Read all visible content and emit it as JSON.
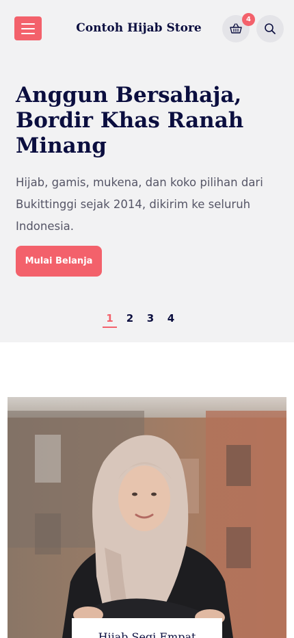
{
  "header": {
    "store_name": "Contoh Hijab Store",
    "cart_count": "4"
  },
  "hero": {
    "title": "Anggun Bersahaja, Bordir Khas Ranah Minang",
    "description": "Hijab, gamis, mukena, dan koko pilihan dari Bukittinggi sejak 2014, dikirim ke seluruh Indonesia.",
    "cta_label": "Mulai Belanja",
    "pages": [
      "1",
      "2",
      "3",
      "4"
    ],
    "active_page": "1"
  },
  "product": {
    "name": "Hijab Segi Empat"
  },
  "colors": {
    "accent": "#f3616b",
    "navy": "#0b0e3f",
    "hero_bg": "#f2f2f3"
  },
  "icons": {
    "menu": "hamburger-icon",
    "cart": "basket-icon",
    "search": "search-icon"
  }
}
